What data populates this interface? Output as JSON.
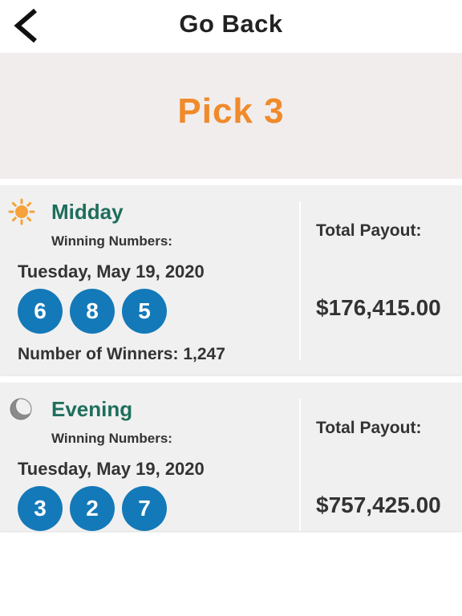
{
  "header": {
    "back_icon": "chevron-left-icon",
    "title": "Go Back"
  },
  "banner": {
    "title": "Pick 3",
    "title_color": "#f08a2a"
  },
  "draws": [
    {
      "icon": "sun-icon",
      "name": "Midday",
      "winning_label": "Winning Numbers:",
      "date": "Tuesday, May 19, 2020",
      "numbers": [
        "6",
        "8",
        "5"
      ],
      "winners_text": "Number of Winners: 1,247",
      "payout_label": "Total Payout:",
      "payout_value": "$176,415.00"
    },
    {
      "icon": "moon-icon",
      "name": "Evening",
      "winning_label": "Winning Numbers:",
      "date": "Tuesday, May 19, 2020",
      "numbers": [
        "3",
        "2",
        "7"
      ],
      "payout_label": "Total Payout:",
      "payout_value": "$757,425.00"
    }
  ],
  "colors": {
    "ball": "#1479b8",
    "draw_name": "#1e6e5c",
    "card_background": "#f0f0f0",
    "banner_background": "#f1eded"
  }
}
